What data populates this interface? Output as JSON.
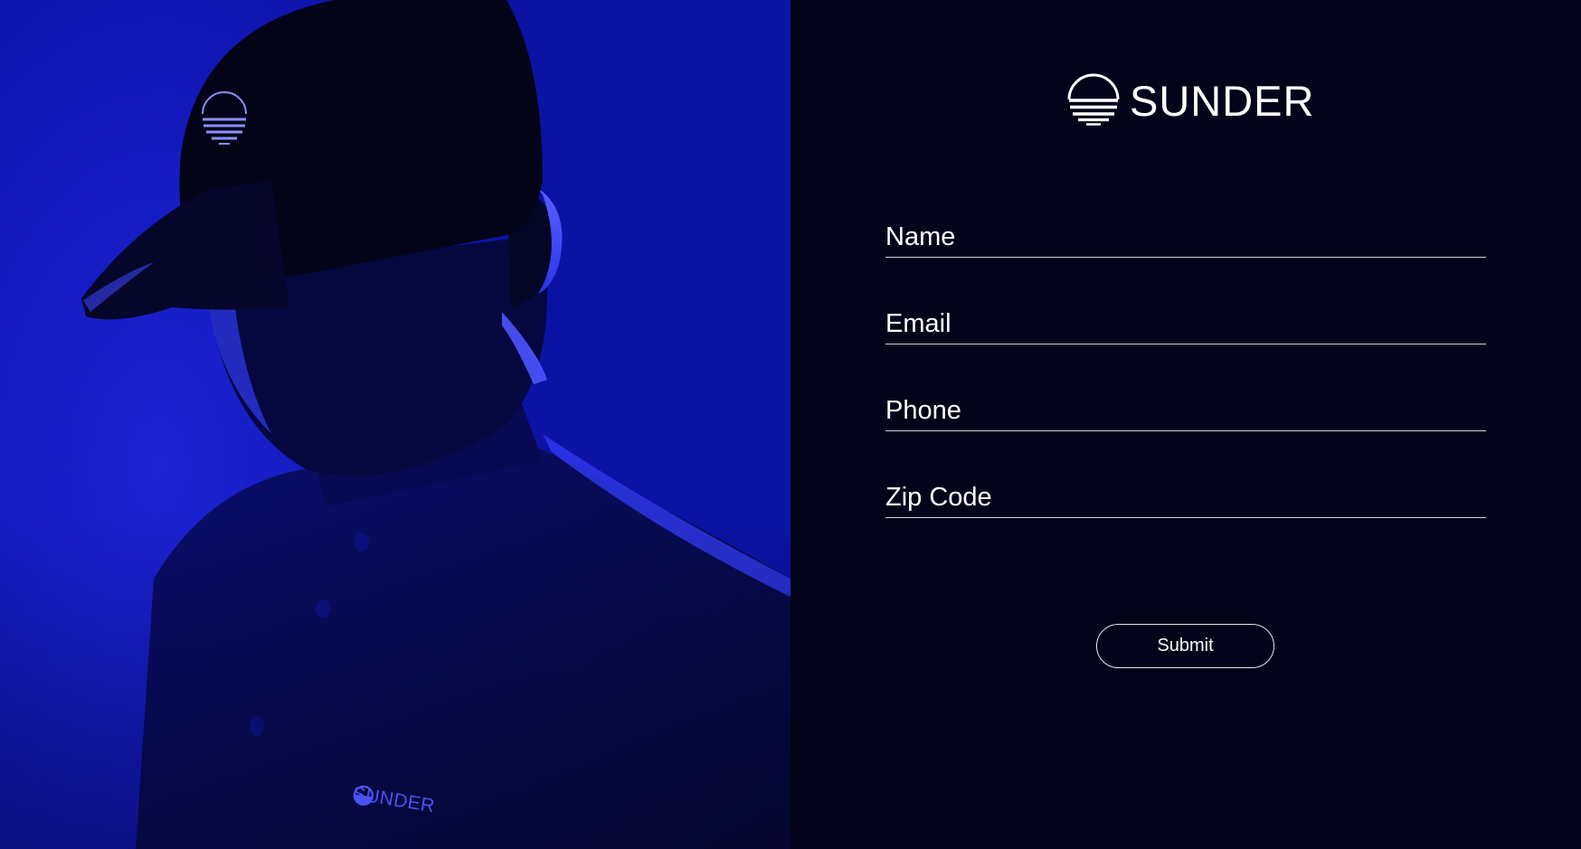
{
  "brand": {
    "name": "SUNDER",
    "logo_icon": "sunder-sun-icon"
  },
  "hero": {
    "image_description_icon": "person-in-cap-photo",
    "shirt_logo_text": "SUNDER",
    "accent_color": "#1a22d0"
  },
  "form": {
    "fields": [
      {
        "name": "name",
        "placeholder": "Name",
        "value": ""
      },
      {
        "name": "email",
        "placeholder": "Email",
        "value": ""
      },
      {
        "name": "phone",
        "placeholder": "Phone",
        "value": ""
      },
      {
        "name": "zip",
        "placeholder": "Zip Code",
        "value": ""
      }
    ],
    "submit_label": "Submit"
  },
  "colors": {
    "panel_background": "#03031a",
    "text": "#ffffff",
    "hero_blue": "#141bc0"
  }
}
